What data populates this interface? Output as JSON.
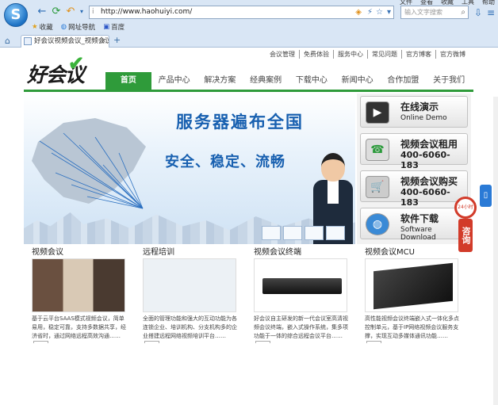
{
  "browser": {
    "url": "http://www.haohuiyi.com/",
    "search_placeholder": "输入文字搜索",
    "top_menu": [
      "文件",
      "查看",
      "收藏",
      "工具",
      "帮助"
    ],
    "favorites": [
      {
        "label": "收藏",
        "icon": "star-icon"
      },
      {
        "label": "网址导航",
        "icon": "globe-icon"
      },
      {
        "label": "百度",
        "icon": "paw-icon"
      }
    ],
    "tab_title": "好会议视频会议_视频会议",
    "new_tab_label": "+"
  },
  "site": {
    "top_links": [
      "会议管理",
      "免费体验",
      "服务中心",
      "常见问题",
      "官方博客",
      "官方微博"
    ],
    "brand": "好会议",
    "nav": [
      "首页",
      "产品中心",
      "解决方案",
      "经典案例",
      "下载中心",
      "新闻中心",
      "合作加盟",
      "关于我们"
    ],
    "active_nav": "首页",
    "banner_title": "服务器遍布全国",
    "banner_sub": "安全、稳定、流畅",
    "side_buttons": [
      {
        "title": "在线演示",
        "sub": "Online Demo",
        "icon": "play-icon"
      },
      {
        "title": "视频会议租用",
        "sub": "400-6060-183",
        "icon": "phone-icon"
      },
      {
        "title": "视频会议购买",
        "sub": "400-6060-183",
        "icon": "cart-icon"
      },
      {
        "title": "软件下载",
        "sub": "Software Download",
        "icon": "globe-icon"
      }
    ],
    "consult": {
      "label": "咨询",
      "clock_text": "24小时"
    },
    "columns": [
      {
        "heading": "视频会议",
        "text": "基于云平台SAAS模式视频会议，简单易用，稳定可靠，支持多数据共享，经济省时，通过网络远程高效沟通……",
        "more": "more"
      },
      {
        "heading": "远程培训",
        "text": "全面的管理功能和强大的互动功能为各连锁企业、培训机构、分支机构多的企业搭建远程网络视频培训平台……",
        "more": "more"
      },
      {
        "heading": "视频会议终端",
        "text": "好会议自主研发的新一代会议室高清视频会议终端，嵌入式操作系统，集多项功能于一体的综合远程会议平台……",
        "more": "more"
      },
      {
        "heading": "视频会议MCU",
        "text": "高性能视频会议终端嵌入式一体化多点控制单元，基于IP网络视频会议服务支撑，实现互动多媒体通讯功能……",
        "more": "more"
      }
    ]
  },
  "colors": {
    "accent_green": "#2f9b3a",
    "accent_blue": "#1860b0",
    "consult_red": "#d23b2a"
  }
}
